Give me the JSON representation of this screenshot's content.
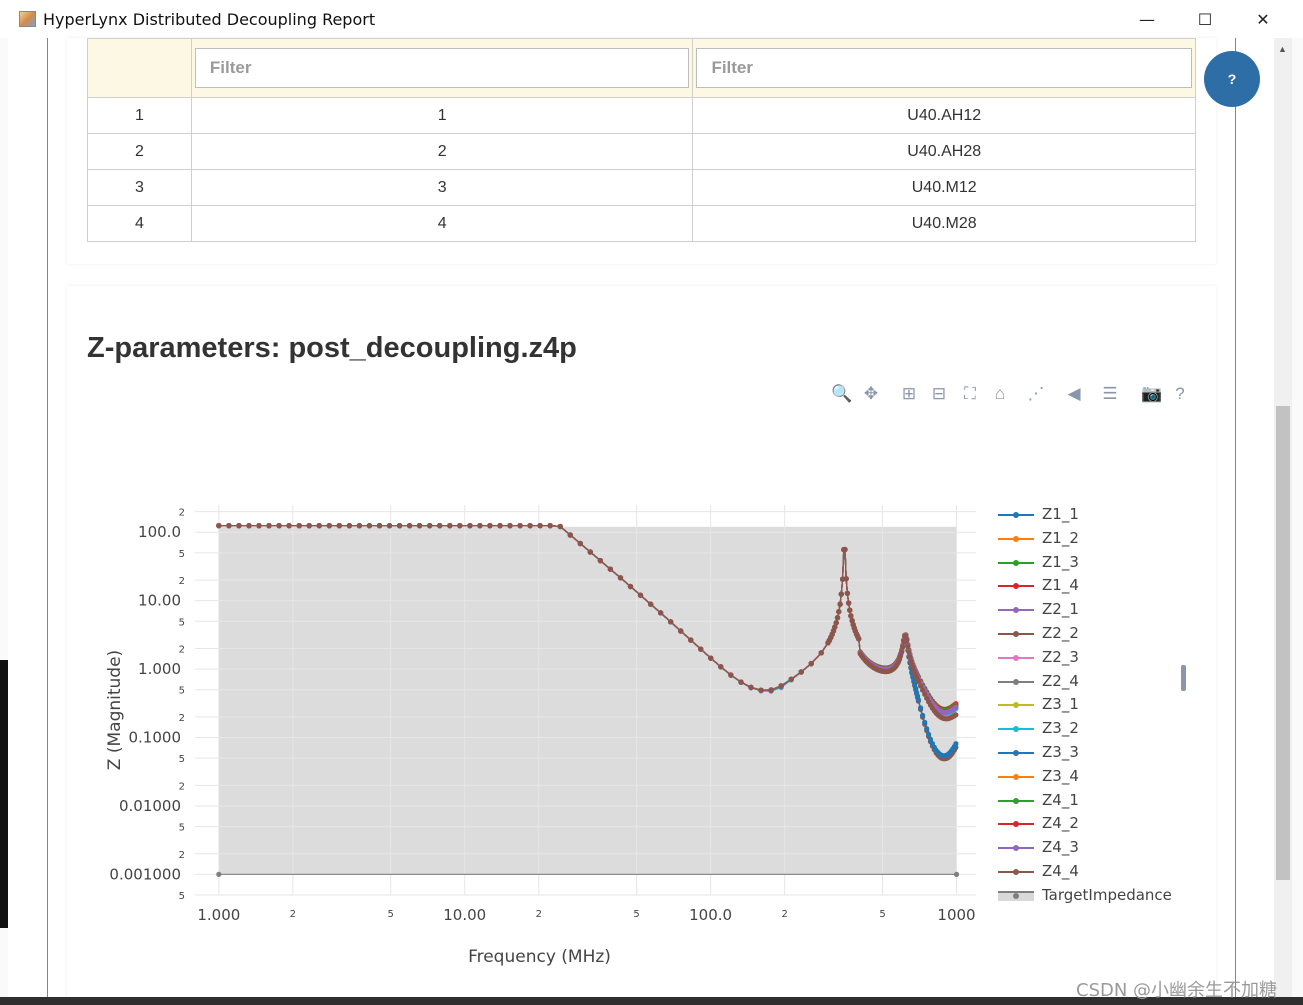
{
  "window": {
    "title": "HyperLynx Distributed Decoupling Report",
    "minimize_glyph": "—",
    "maximize_glyph": "☐",
    "close_glyph": "✕"
  },
  "table": {
    "filter_placeholders": [
      "Filter",
      "Filter"
    ],
    "rows": [
      [
        "1",
        "1",
        "U40.AH12"
      ],
      [
        "2",
        "2",
        "U40.AH28"
      ],
      [
        "3",
        "3",
        "U40.M12"
      ],
      [
        "4",
        "4",
        "U40.M28"
      ]
    ]
  },
  "help_button": {
    "label": "?"
  },
  "chart_section": {
    "title": "Z-parameters: post_decoupling.z4p"
  },
  "modebar": [
    {
      "icon": "zoom-icon",
      "glyph": "🔍"
    },
    {
      "icon": "pan-icon",
      "glyph": "✥"
    },
    {
      "icon": "zoom-in-icon",
      "glyph": "⊞"
    },
    {
      "icon": "zoom-out-icon",
      "glyph": "⊟"
    },
    {
      "icon": "autoscale-icon",
      "glyph": "⛶"
    },
    {
      "icon": "reset-axes-icon",
      "glyph": "⌂"
    },
    {
      "icon": "spike-lines-icon",
      "glyph": "⋰"
    },
    {
      "icon": "hover-closest-icon",
      "glyph": "◀"
    },
    {
      "icon": "hover-compare-icon",
      "glyph": "☰"
    },
    {
      "icon": "camera-icon",
      "glyph": "📷"
    },
    {
      "icon": "question-icon",
      "glyph": "?"
    }
  ],
  "watermark": "CSDN @小幽余生不加糖",
  "chart_data": {
    "type": "line",
    "xlabel": "Frequency (MHz)",
    "ylabel": "Z (Magnitude)",
    "x_scale": "log",
    "y_scale": "log",
    "xlim": [
      0.8,
      1200
    ],
    "ylim": [
      0.0005,
      250
    ],
    "grid": true,
    "legend_position": "right",
    "x_major_ticks": [
      {
        "value": 1,
        "label": "1.000"
      },
      {
        "value": 10,
        "label": "10.00"
      },
      {
        "value": 100,
        "label": "100.0"
      },
      {
        "value": 1000,
        "label": "1000"
      }
    ],
    "x_minor_ticks": [
      {
        "value": 2,
        "label": "2"
      },
      {
        "value": 5,
        "label": "5"
      },
      {
        "value": 20,
        "label": "2"
      },
      {
        "value": 50,
        "label": "5"
      },
      {
        "value": 200,
        "label": "2"
      },
      {
        "value": 500,
        "label": "5"
      }
    ],
    "y_major_ticks": [
      {
        "value": 100,
        "label": "100.0"
      },
      {
        "value": 10,
        "label": "10.00"
      },
      {
        "value": 1,
        "label": "1.000"
      },
      {
        "value": 0.1,
        "label": "0.1000"
      },
      {
        "value": 0.01,
        "label": "0.01000"
      },
      {
        "value": 0.001,
        "label": "0.001000"
      }
    ],
    "y_minor_ticks": [
      {
        "value": 200,
        "label": "2"
      },
      {
        "value": 50,
        "label": "5"
      },
      {
        "value": 20,
        "label": "2"
      },
      {
        "value": 5,
        "label": "5"
      },
      {
        "value": 2,
        "label": "2"
      },
      {
        "value": 0.5,
        "label": "5"
      },
      {
        "value": 0.2,
        "label": "2"
      },
      {
        "value": 0.05,
        "label": "5"
      },
      {
        "value": 0.02,
        "label": "2"
      },
      {
        "value": 0.005,
        "label": "5"
      },
      {
        "value": 0.002,
        "label": "2"
      },
      {
        "value": 0.0005,
        "label": "5"
      }
    ],
    "target_region": {
      "x": [
        1,
        1000
      ],
      "y": [
        0.001,
        120
      ]
    },
    "series": [
      {
        "name": "Z1_1",
        "color": "#1f77b4",
        "params": {
          "dipA": 0.02,
          "dipB": 0.02,
          "hf": 0.22
        }
      },
      {
        "name": "Z1_2",
        "color": "#ff7f0e",
        "params": {
          "dipA": 0.018,
          "dipB": 0.03,
          "hf": 0.21
        }
      },
      {
        "name": "Z1_3",
        "color": "#2ca02c",
        "params": {
          "dipA": 0.016,
          "dipB": 0.035,
          "hf": 0.24
        }
      },
      {
        "name": "Z1_4",
        "color": "#d62728",
        "params": {
          "dipA": 0.017,
          "dipB": 0.03,
          "hf": 0.23
        }
      },
      {
        "name": "Z2_1",
        "color": "#9467bd",
        "params": {
          "dipA": 0.015,
          "dipB": 0.025,
          "hf": 0.18
        }
      },
      {
        "name": "Z2_2",
        "color": "#8c564b",
        "params": {
          "dipA": 0.018,
          "dipB": 0.002,
          "hf": 0.1
        }
      },
      {
        "name": "Z2_3",
        "color": "#e377c2",
        "params": {
          "dipA": 0.016,
          "dipB": 0.02,
          "hf": 0.19
        }
      },
      {
        "name": "Z2_4",
        "color": "#7f7f7f",
        "params": {
          "dipA": 0.017,
          "dipB": 0.02,
          "hf": 0.17
        }
      },
      {
        "name": "Z3_1",
        "color": "#bcbd22",
        "params": {
          "dipA": 0.015,
          "dipB": 0.025,
          "hf": 0.2
        }
      },
      {
        "name": "Z3_2",
        "color": "#17becf",
        "params": {
          "dipA": 0.004,
          "dipB": 0.01,
          "hf": 0.16
        }
      },
      {
        "name": "Z3_3",
        "color": "#1f77b4",
        "params": {
          "dipA": 0.013,
          "dipB": 0.002,
          "hf": 0.15
        }
      },
      {
        "name": "Z3_4",
        "color": "#ff7f0e",
        "params": {
          "dipA": 0.016,
          "dipB": 0.02,
          "hf": 0.2
        }
      },
      {
        "name": "Z4_1",
        "color": "#2ca02c",
        "params": {
          "dipA": 0.017,
          "dipB": 0.03,
          "hf": 0.21
        }
      },
      {
        "name": "Z4_2",
        "color": "#d62728",
        "params": {
          "dipA": 0.016,
          "dipB": 0.025,
          "hf": 0.19
        }
      },
      {
        "name": "Z4_3",
        "color": "#9467bd",
        "params": {
          "dipA": 0.016,
          "dipB": 0.02,
          "hf": 0.18
        }
      },
      {
        "name": "Z4_4",
        "color": "#8c564b",
        "params": {
          "dipA": 0.015,
          "dipB": 0.01,
          "hf": 0.08
        }
      },
      {
        "name": "TargetImpedance",
        "color": "#7f7f7f",
        "x": [
          1,
          1000
        ],
        "y": [
          0.001,
          0.001
        ]
      }
    ]
  }
}
